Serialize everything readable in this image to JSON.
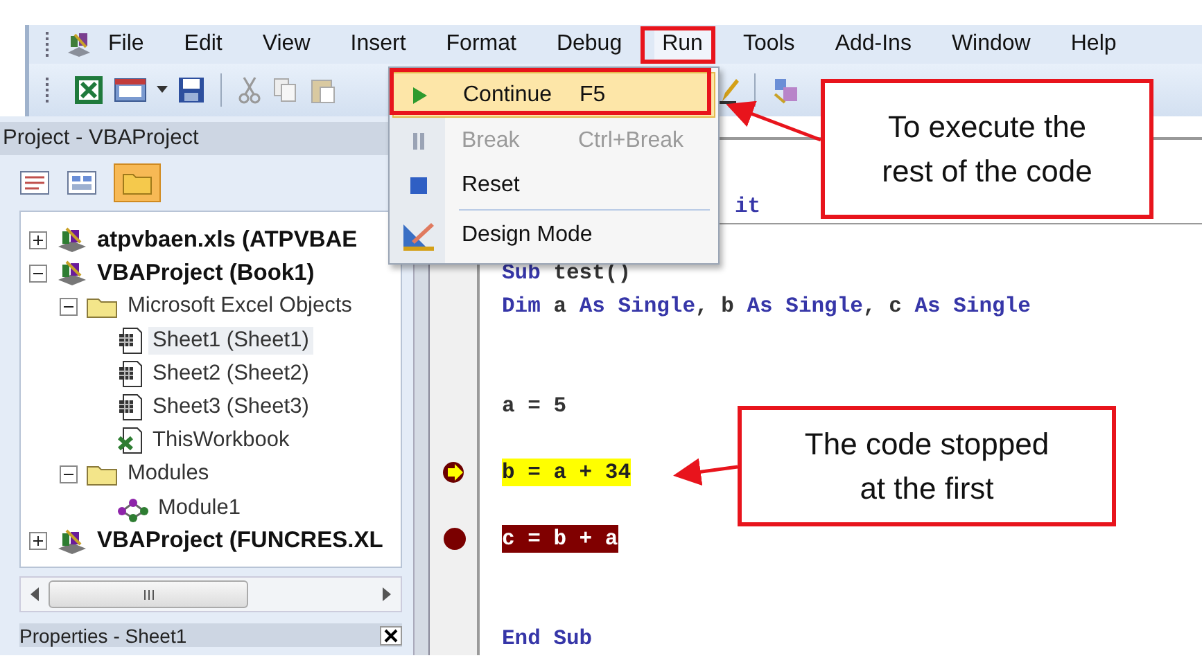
{
  "menubar": {
    "items": [
      {
        "label": "File",
        "selected": false
      },
      {
        "label": "Edit",
        "selected": false
      },
      {
        "label": "View",
        "selected": false
      },
      {
        "label": "Insert",
        "selected": false
      },
      {
        "label": "Format",
        "selected": false
      },
      {
        "label": "Debug",
        "selected": false
      },
      {
        "label": "Run",
        "selected": true
      },
      {
        "label": "Tools",
        "selected": false
      },
      {
        "label": "Add-Ins",
        "selected": false
      },
      {
        "label": "Window",
        "selected": false
      },
      {
        "label": "Help",
        "selected": false
      }
    ]
  },
  "run_menu": {
    "items": [
      {
        "label": "Continue",
        "shortcut": "F5",
        "kind": "play",
        "selected": true,
        "disabled": false
      },
      {
        "label": "Break",
        "shortcut": "Ctrl+Break",
        "kind": "pause",
        "selected": false,
        "disabled": true
      },
      {
        "label": "Reset",
        "kind": "stop",
        "selected": false,
        "disabled": false
      },
      {
        "label": "Design Mode",
        "kind": "design",
        "selected": false,
        "disabled": false
      }
    ]
  },
  "project_panel": {
    "title": "Project - VBAProject",
    "tree": [
      {
        "label": "atpvbaen.xls (ATPVBAE",
        "kind": "project",
        "expanded": false,
        "selected": false
      },
      {
        "label": "VBAProject (Book1)",
        "kind": "project",
        "expanded": true,
        "selected": false,
        "children": [
          {
            "label": "Microsoft Excel Objects",
            "kind": "folder",
            "expanded": true,
            "selected": false,
            "children": [
              {
                "label": "Sheet1 (Sheet1)",
                "kind": "sheet",
                "selected": true
              },
              {
                "label": "Sheet2 (Sheet2)",
                "kind": "sheet",
                "selected": false
              },
              {
                "label": "Sheet3 (Sheet3)",
                "kind": "sheet",
                "selected": false
              },
              {
                "label": "ThisWorkbook",
                "kind": "workbook",
                "selected": false
              }
            ]
          },
          {
            "label": "Modules",
            "kind": "folder",
            "expanded": true,
            "selected": false,
            "children": [
              {
                "label": "Module1",
                "kind": "module",
                "selected": false
              }
            ]
          }
        ]
      },
      {
        "label": "VBAProject (FUNCRES.XL",
        "kind": "project",
        "expanded": false,
        "selected": false
      }
    ]
  },
  "properties_panel": {
    "title": "Properties - Sheet1"
  },
  "code": {
    "lines": [
      {
        "current": false,
        "breakpoint": false,
        "segments": [
          {
            "text": "it",
            "kind": "keyword"
          }
        ]
      },
      {
        "current": false,
        "breakpoint": false,
        "segments": [
          {
            "text": "Sub",
            "kind": "keyword"
          },
          {
            "text": " test()",
            "kind": "plain"
          }
        ]
      },
      {
        "current": false,
        "breakpoint": false,
        "segments": [
          {
            "text": "Dim",
            "kind": "keyword"
          },
          {
            "text": " a ",
            "kind": "plain"
          },
          {
            "text": "As Single",
            "kind": "keyword"
          },
          {
            "text": ", b ",
            "kind": "plain"
          },
          {
            "text": "As Single",
            "kind": "keyword"
          },
          {
            "text": ", c ",
            "kind": "plain"
          },
          {
            "text": "As Single",
            "kind": "keyword"
          }
        ]
      },
      {
        "current": false,
        "breakpoint": false,
        "segments": [
          {
            "text": "a = 5",
            "kind": "plain"
          }
        ]
      },
      {
        "current": true,
        "breakpoint": false,
        "segments": [
          {
            "text": "b = a + 34",
            "kind": "plain"
          }
        ]
      },
      {
        "current": false,
        "breakpoint": true,
        "segments": [
          {
            "text": "c = b + a",
            "kind": "plain"
          }
        ]
      },
      {
        "current": false,
        "breakpoint": false,
        "segments": [
          {
            "text": "End Sub",
            "kind": "keyword"
          }
        ]
      }
    ]
  },
  "callouts": [
    {
      "lines": [
        "To execute the",
        "rest of the code"
      ]
    },
    {
      "lines": [
        "The code stopped",
        "at the first"
      ]
    }
  ]
}
